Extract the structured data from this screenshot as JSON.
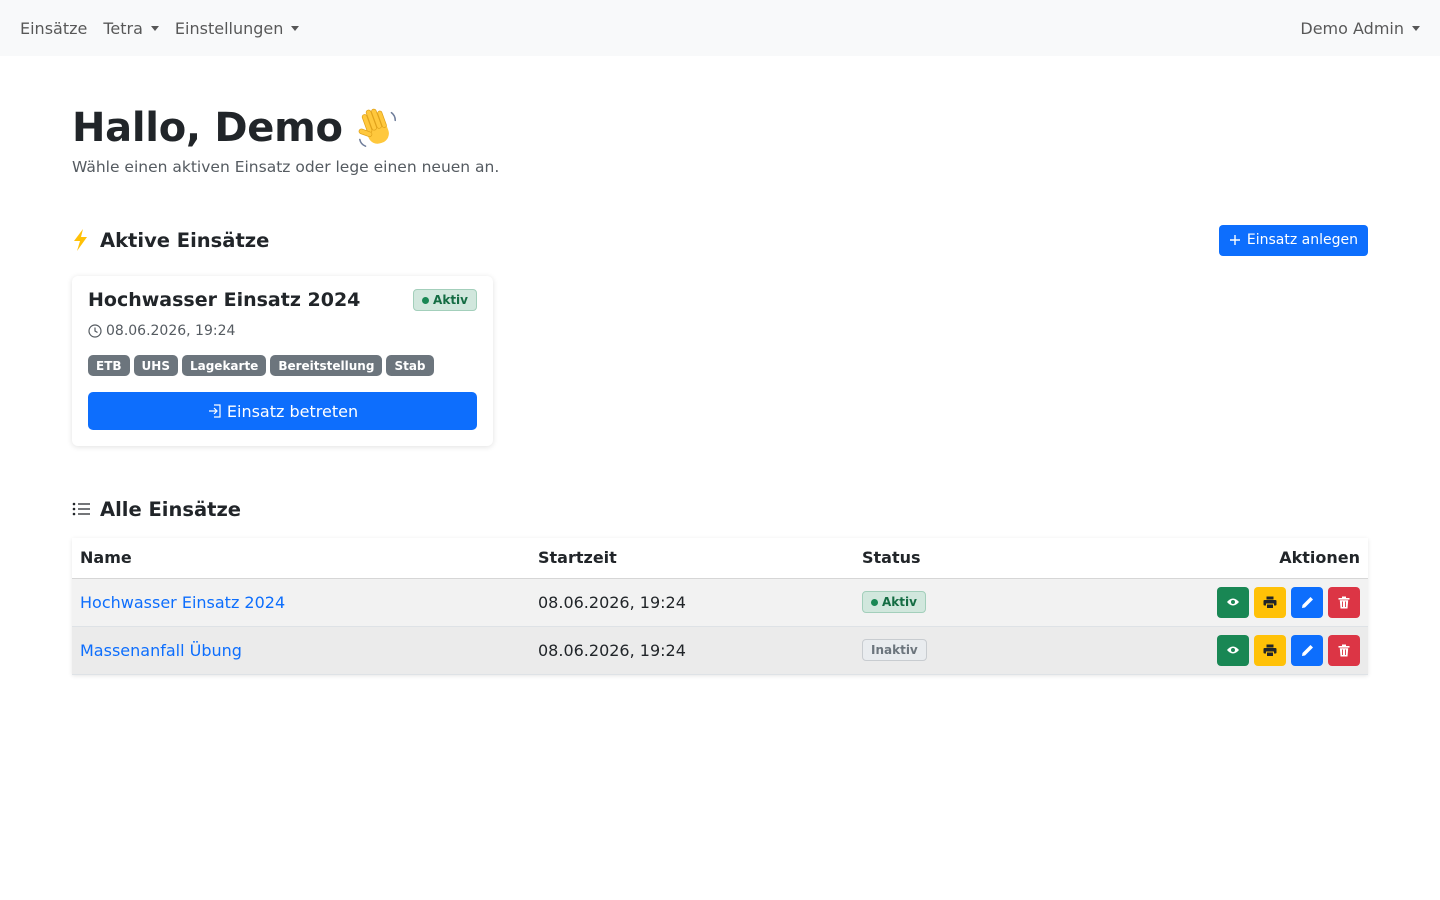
{
  "nav": {
    "items": [
      {
        "label": "Einsätze"
      },
      {
        "label": "Tetra"
      },
      {
        "label": "Einstellungen"
      }
    ],
    "user": "Demo Admin"
  },
  "greeting": {
    "title": "Hallo, Demo",
    "emoji": "waving-hand-icon",
    "subtitle": "Wähle einen aktiven Einsatz oder lege einen neuen an."
  },
  "active_section": {
    "title": "Aktive Einsätze",
    "icon": "lightning-icon",
    "create_button": "Einsatz anlegen",
    "card": {
      "title": "Hochwasser Einsatz 2024",
      "status": "Aktiv",
      "time": "08.06.2026, 19:24",
      "tags": [
        "ETB",
        "UHS",
        "Lagekarte",
        "Bereitstellung",
        "Stab"
      ],
      "enter_button": "Einsatz betreten"
    }
  },
  "all_section": {
    "title": "Alle Einsätze",
    "icon": "list-icon",
    "columns": [
      "Name",
      "Startzeit",
      "Status",
      "Aktionen"
    ],
    "rows": [
      {
        "name": "Hochwasser Einsatz 2024",
        "start": "08.06.2026, 19:24",
        "status": "Aktiv"
      },
      {
        "name": "Massenanfall Übung",
        "start": "08.06.2026, 19:24",
        "status": "Inaktiv"
      }
    ]
  },
  "colors": {
    "primary": "#0d6efd",
    "success": "#198754",
    "warning": "#ffc107",
    "danger": "#dc3545",
    "secondary": "#6c757d"
  }
}
